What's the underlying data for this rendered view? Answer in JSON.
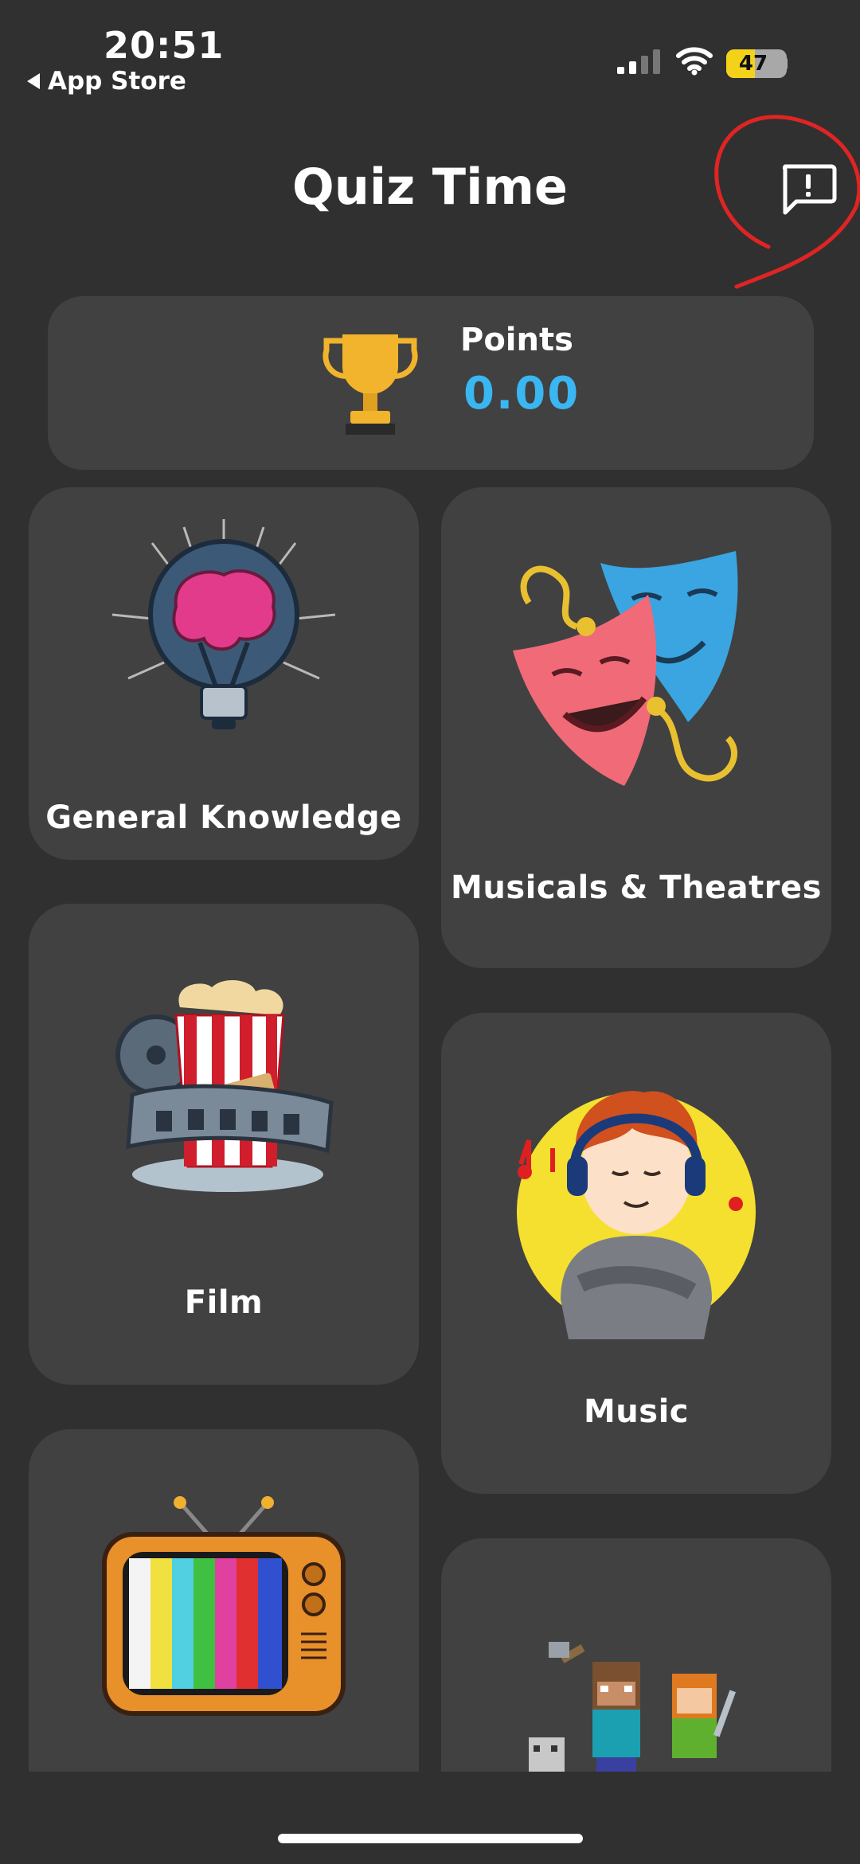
{
  "status_bar": {
    "time": "20:51",
    "back_label": "App Store",
    "battery_level": 47,
    "battery_text": "47"
  },
  "header": {
    "title": "Quiz Time",
    "feedback_icon": "report-message-icon"
  },
  "points": {
    "label": "Points",
    "value": "0.00",
    "icon": "trophy-icon",
    "value_color": "#3ab6f2"
  },
  "categories": [
    {
      "label": "General Knowledge",
      "icon": "brain-lightbulb-icon"
    },
    {
      "label": "Musicals & Theatres",
      "icon": "theatre-masks-icon"
    },
    {
      "label": "Film",
      "icon": "popcorn-film-reel-icon"
    },
    {
      "label": "Music",
      "icon": "boy-headphones-icon"
    },
    {
      "label": "",
      "icon": "retro-tv-icon"
    },
    {
      "label": "",
      "icon": "minecraft-characters-icon"
    }
  ],
  "colors": {
    "background": "#303030",
    "card": "#414141",
    "accent": "#3ab6f2",
    "battery": "#f5d21a",
    "annotation": "#e02424"
  }
}
